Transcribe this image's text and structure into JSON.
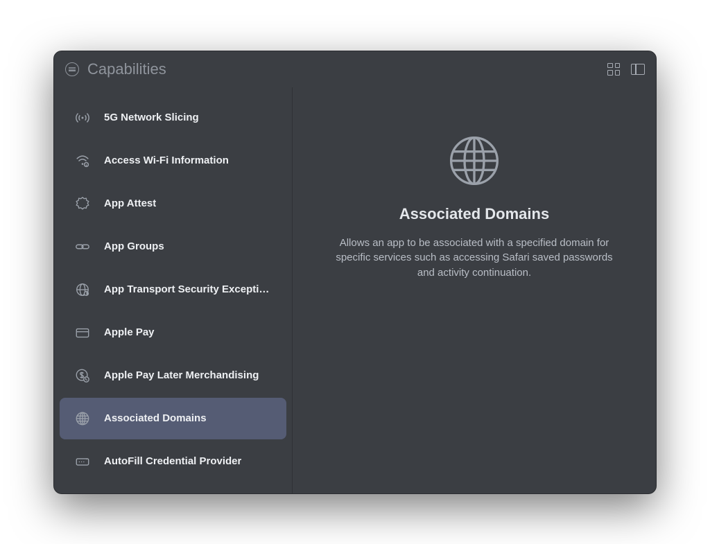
{
  "header": {
    "title": "Capabilities"
  },
  "sidebar": {
    "items": [
      {
        "label": "5G Network Slicing",
        "icon": "antenna-icon",
        "selected": false
      },
      {
        "label": "Access Wi-Fi Information",
        "icon": "wifi-info-icon",
        "selected": false
      },
      {
        "label": "App Attest",
        "icon": "seal-icon",
        "selected": false
      },
      {
        "label": "App Groups",
        "icon": "link-icon",
        "selected": false
      },
      {
        "label": "App Transport Security Excepti…",
        "icon": "globe-half-icon",
        "selected": false
      },
      {
        "label": "Apple Pay",
        "icon": "card-icon",
        "selected": false
      },
      {
        "label": "Apple Pay Later Merchandising",
        "icon": "dollar-badge-icon",
        "selected": false
      },
      {
        "label": "Associated Domains",
        "icon": "globe-icon",
        "selected": true
      },
      {
        "label": "AutoFill Credential Provider",
        "icon": "password-icon",
        "selected": false
      }
    ]
  },
  "detail": {
    "title": "Associated Domains",
    "description": "Allows an app to be associated with a specified domain for specific services such as accessing Safari saved passwords and activity continuation.",
    "icon": "globe-icon"
  }
}
